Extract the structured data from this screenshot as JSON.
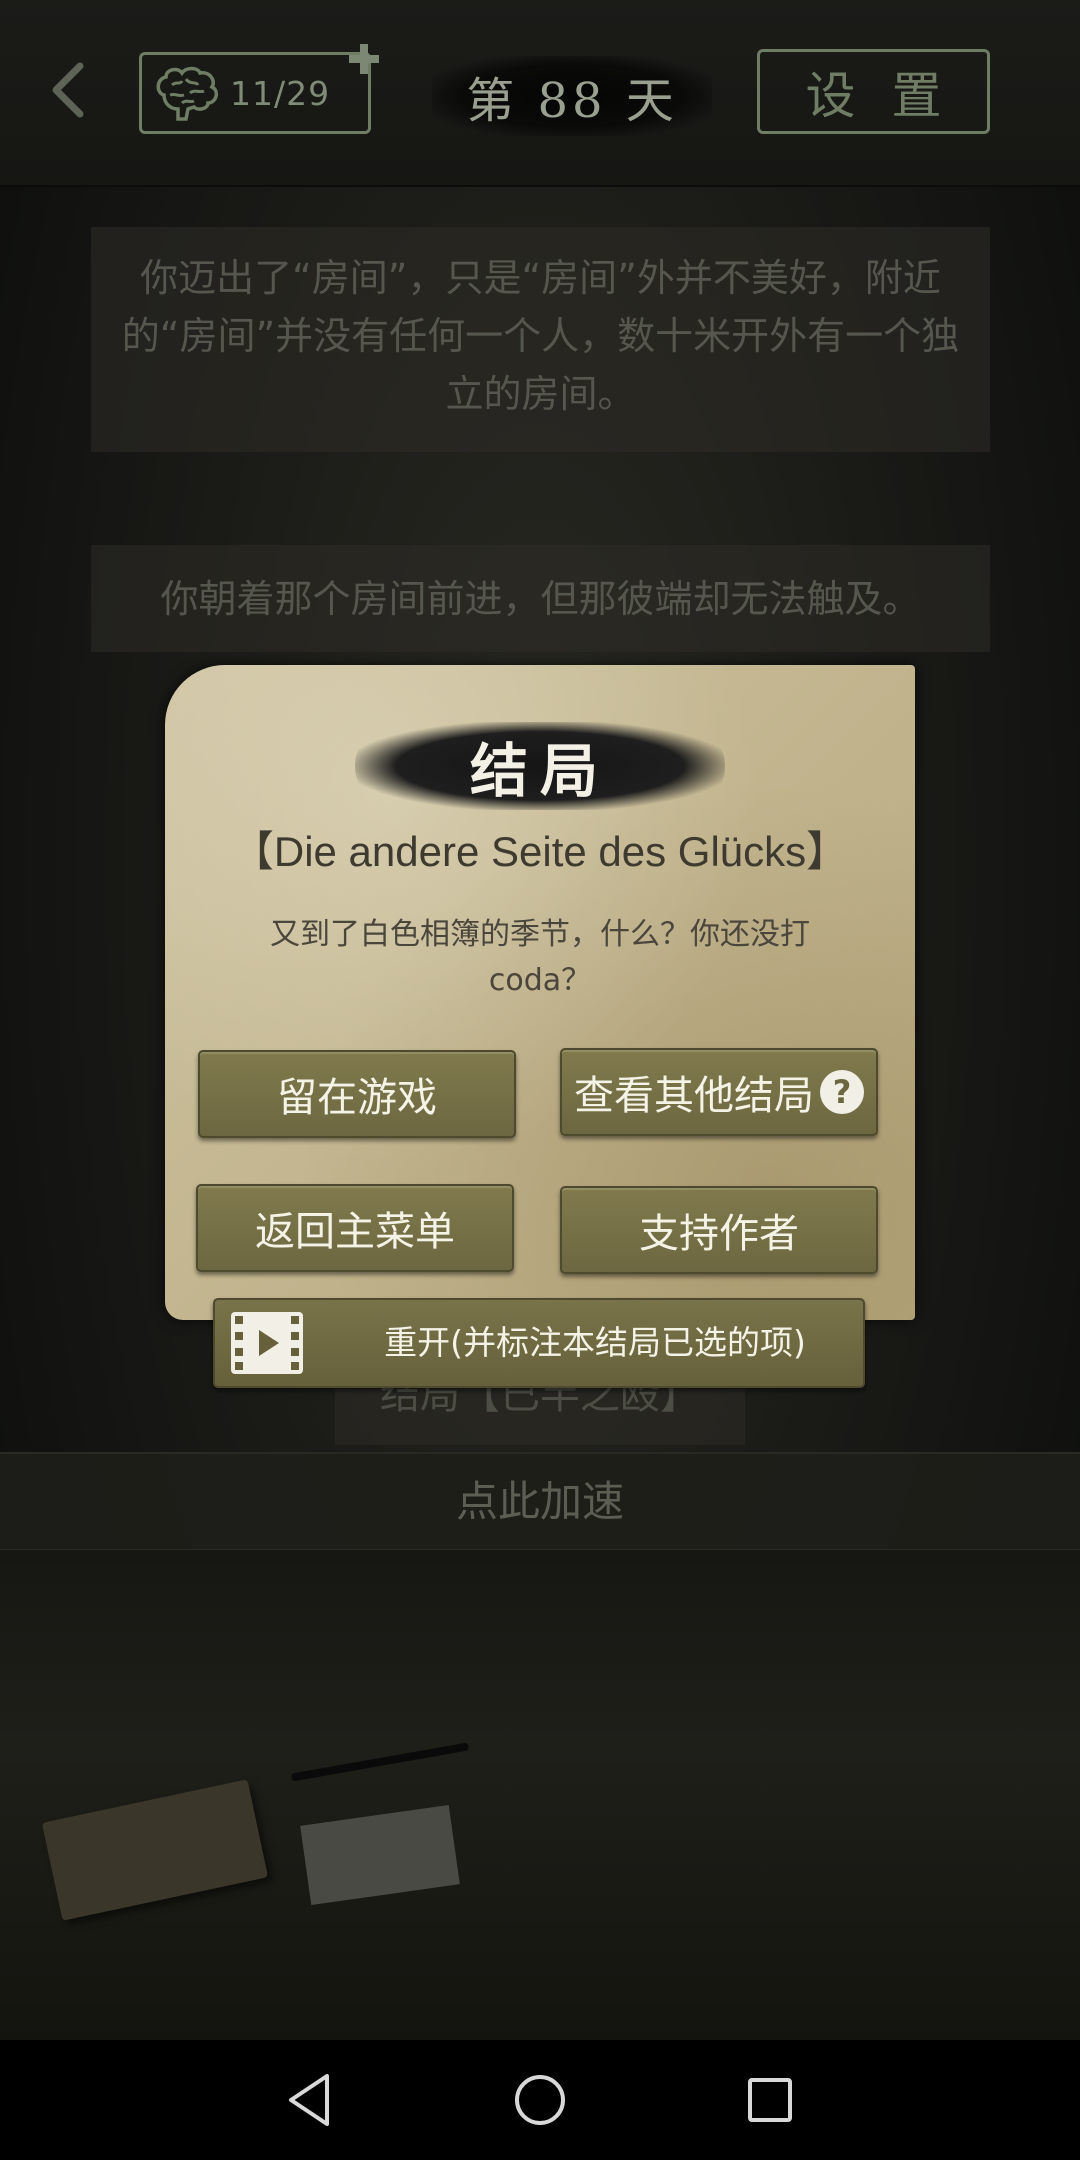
{
  "topbar": {
    "brain_count": "11/29",
    "day_label": "第 88 天",
    "settings_label": "设置"
  },
  "story": {
    "paragraph_1": "你迈出了“房间”，只是“房间”外并不美好，附近的“房间”并没有任何一个人，数十米开外有一个独立的房间。",
    "paragraph_2": "你朝着那个房间前进，但那彼端却无法触及。",
    "ending_strip": "结局【已半之殴】",
    "speed_up": "点此加速"
  },
  "dialog": {
    "title": "结局",
    "ending_name": "【Die andere Seite des Glücks】",
    "description": "又到了白色相簿的季节，什么？你还没打coda？",
    "buttons": {
      "stay": "留在游戏",
      "other_endings": "查看其他结局",
      "main_menu": "返回主菜单",
      "support": "支持作者",
      "restart": "重开(并标注本结局已选的项)"
    },
    "help_symbol": "?"
  },
  "icons": {
    "back": "chevron-left-icon",
    "brain": "brain-icon",
    "plus": "plus-icon",
    "help": "question-icon",
    "film": "film-play-icon",
    "nav_back": "triangle-back-icon",
    "nav_home": "circle-home-icon",
    "nav_recent": "square-recent-icon"
  },
  "colors": {
    "accent_green": "#6f7d65",
    "parchment": "#c3b690",
    "button_olive": "#76704a"
  }
}
